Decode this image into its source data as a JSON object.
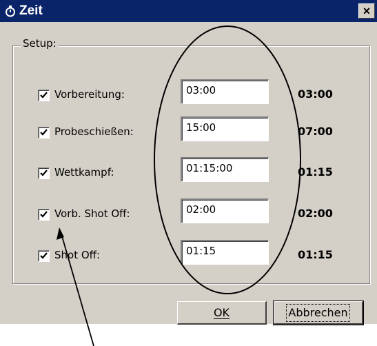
{
  "window": {
    "title": "Zeit",
    "icon": "stopwatch-icon",
    "close_glyph": "×"
  },
  "group": {
    "label": "Setup:"
  },
  "rows": [
    {
      "label": "Vorbereitung:",
      "input_value": "03:00",
      "display_value": "03:00",
      "checked": true
    },
    {
      "label": "Probeschießen:",
      "input_value": "15:00",
      "display_value": "07:00",
      "checked": true
    },
    {
      "label": "Wettkampf:",
      "input_value": "01:15:00",
      "display_value": "01:15",
      "checked": true
    },
    {
      "label": "Vorb. Shot Off:",
      "input_value": "02:00",
      "display_value": "02:00",
      "checked": true
    },
    {
      "label": "Shot Off:",
      "input_value": "01:15",
      "display_value": "01:15",
      "checked": true
    }
  ],
  "buttons": {
    "ok_label": "OK",
    "cancel_label": "Abbrechen"
  },
  "colors": {
    "titlebar": "#0a246a",
    "dialog_bg": "#d4d0c8"
  }
}
